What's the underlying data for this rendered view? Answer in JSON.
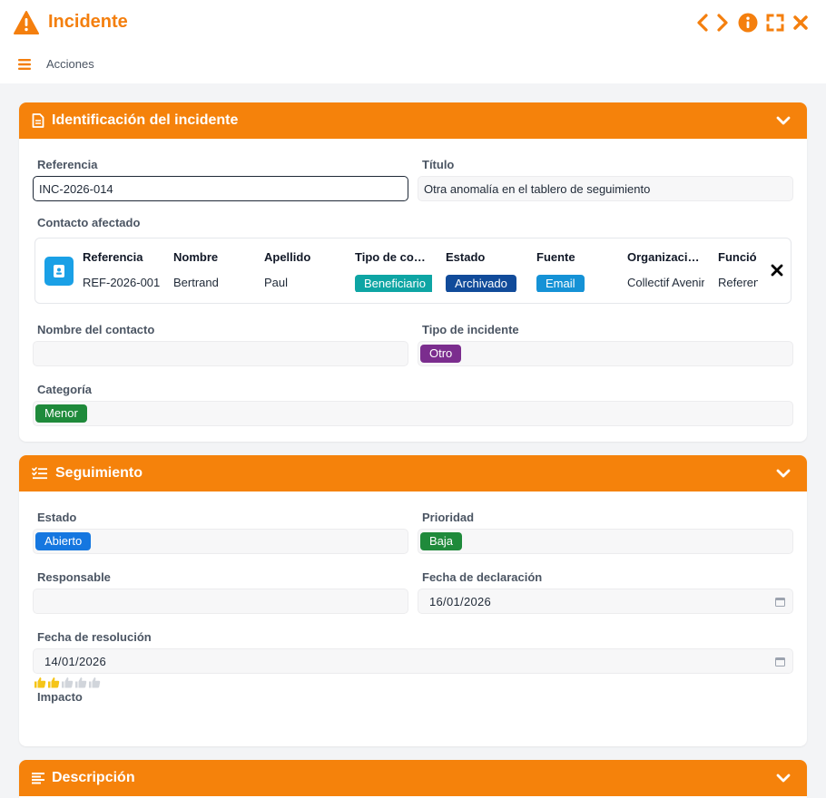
{
  "window": {
    "title": "Incidente",
    "icons": [
      "warning-icon",
      "chevron-left-icon",
      "chevron-right-icon",
      "info-icon",
      "fullscreen-icon",
      "close-icon"
    ]
  },
  "actions": {
    "label": "Acciones"
  },
  "sections": {
    "identification": {
      "title": "Identificación del incidente",
      "referencia_label": "Referencia",
      "referencia_value": "INC-2026-014",
      "titulo_label": "Título",
      "titulo_value": "Otra anomalía en el tablero de seguimiento",
      "contacto_label": "Contacto afectado",
      "contact": {
        "headers": [
          "Referencia",
          "Nombre",
          "Apellido",
          "Tipo de co…",
          "Estado",
          "Fuente",
          "Organizaci…",
          "Funció"
        ],
        "values": {
          "referencia": "REF-2026-001",
          "nombre": "Bertrand",
          "apellido": "Paul",
          "tipo": "Beneficiario",
          "estado": "Archivado",
          "fuente": "Email",
          "organizacion": "Collectif Avenir",
          "funcion": "Referente"
        }
      },
      "nombre_contacto_label": "Nombre del contacto",
      "nombre_contacto_value": "",
      "tipo_incidente_label": "Tipo de incidente",
      "tipo_incidente_value": "Otro",
      "categoria_label": "Categoría",
      "categoria_value": "Menor"
    },
    "seguimiento": {
      "title": "Seguimiento",
      "estado_label": "Estado",
      "estado_value": "Abierto",
      "prioridad_label": "Prioridad",
      "prioridad_value": "Baja",
      "responsable_label": "Responsable",
      "responsable_value": "",
      "fecha_declaracion_label": "Fecha de declaración",
      "fecha_declaracion_value": "16/01/2026",
      "fecha_resolucion_label": "Fecha de resolución",
      "fecha_resolucion_value": "14/01/2026",
      "impacto_label": "Impacto",
      "impacto_rating": 2,
      "impacto_max": 5
    },
    "descripcion": {
      "title": "Descripción"
    }
  },
  "colors": {
    "accent": "#f5820b",
    "tag_teal": "#0ea5a4",
    "tag_navy": "#114b9a",
    "tag_blue": "#1592d6",
    "tag_purple": "#7b2d8e",
    "tag_green": "#1f8a3b",
    "tag_bright_blue": "#1577e0"
  }
}
